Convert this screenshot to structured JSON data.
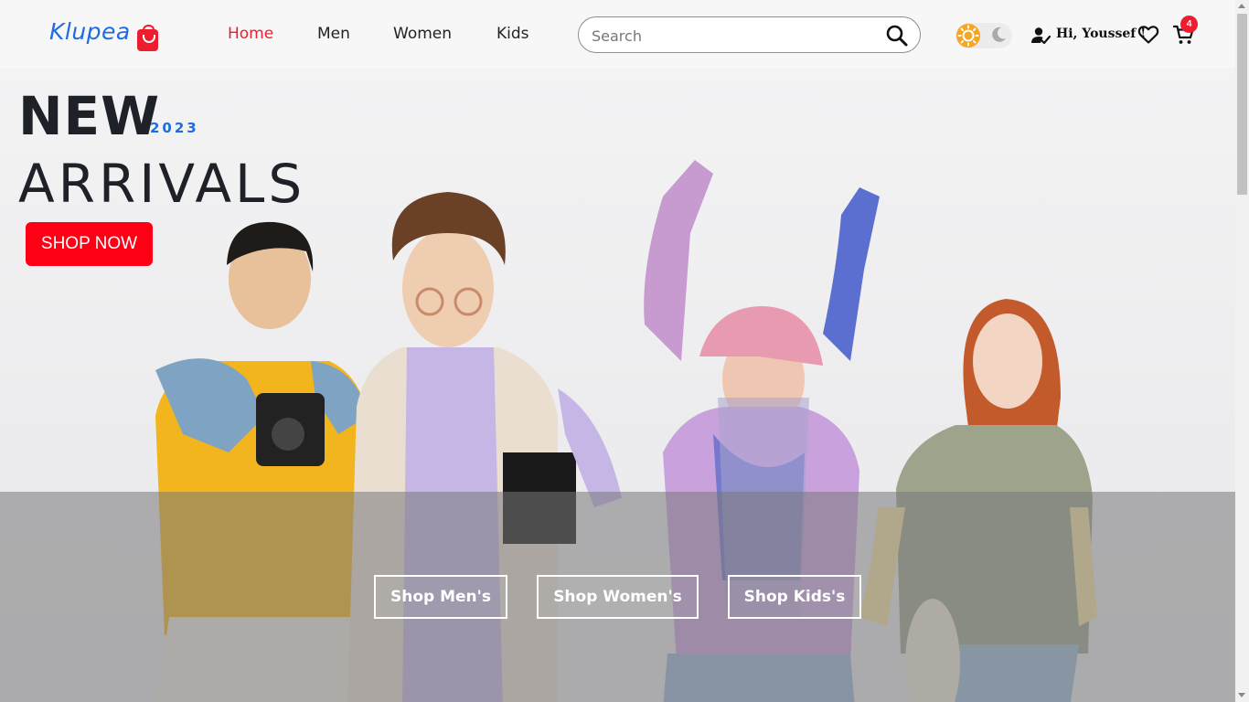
{
  "brand": {
    "name": "Klupea",
    "logo_icon": "shopping-bag-icon",
    "accent": "#1f6be0",
    "brand_red": "#ee1c2e"
  },
  "nav": {
    "items": [
      {
        "label": "Home",
        "active": true
      },
      {
        "label": "Men",
        "active": false
      },
      {
        "label": "Women",
        "active": false
      },
      {
        "label": "Kids",
        "active": false
      }
    ]
  },
  "search": {
    "placeholder": "Search",
    "value": "",
    "icon": "search-icon"
  },
  "theme_toggle": {
    "current": "light",
    "icons": [
      "sun-icon",
      "moon-icon"
    ]
  },
  "user": {
    "greeting": "Hi, Youssef !",
    "icon": "user-check-icon"
  },
  "wishlist": {
    "icon": "heart-icon"
  },
  "cart": {
    "icon": "cart-icon",
    "count": "4"
  },
  "hero": {
    "title_line1": "NEW",
    "year": "2023",
    "title_line2": "ARRIVALS",
    "cta": "SHOP NOW",
    "image": "group of four young people in colorful streetwear",
    "categories": [
      {
        "label": "Shop Men's"
      },
      {
        "label": "Shop Women's"
      },
      {
        "label": "Shop Kids's"
      }
    ]
  }
}
